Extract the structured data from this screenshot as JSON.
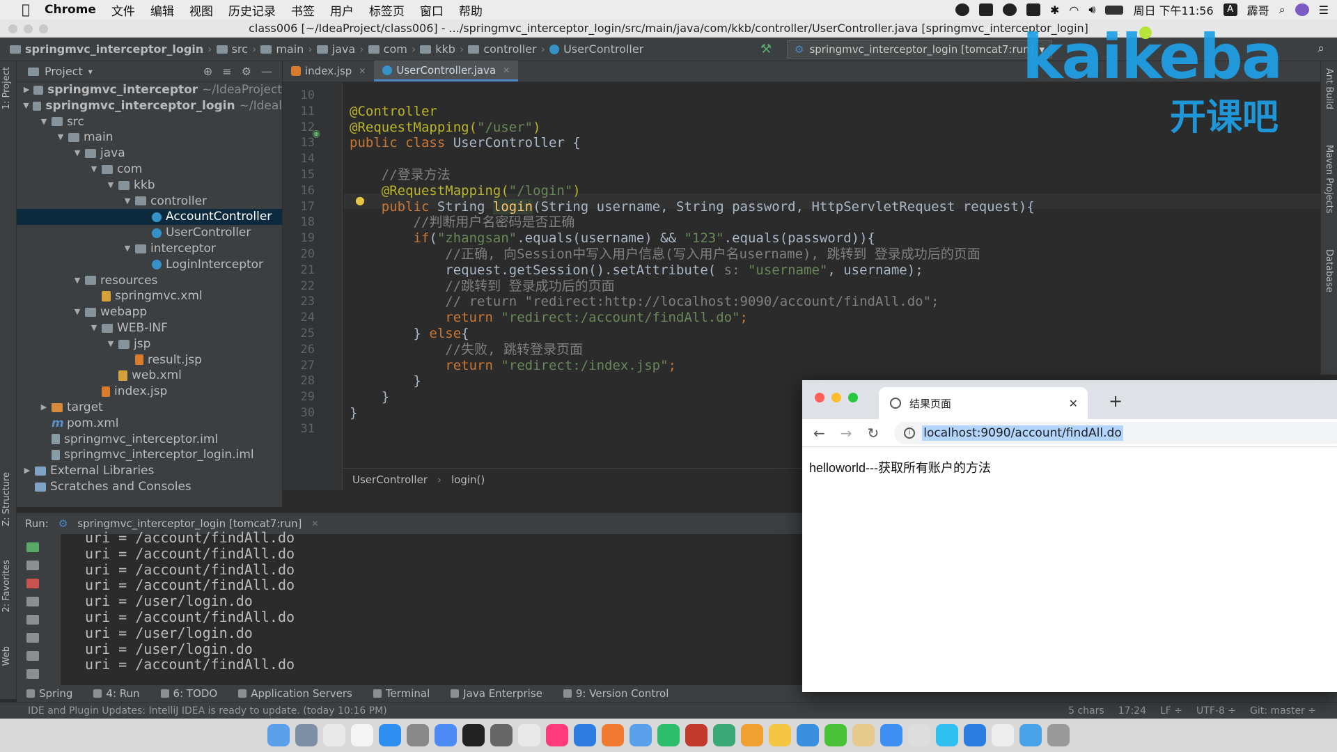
{
  "menubar": {
    "app": "Chrome",
    "items": [
      "文件",
      "编辑",
      "视图",
      "历史记录",
      "书签",
      "用户",
      "标签页",
      "窗口",
      "帮助"
    ],
    "datetime": "周日 下午11:56",
    "user": "霹哥"
  },
  "window_title": "class006 [~/IdeaProject/class006] - .../springmvc_interceptor_login/src/main/java/com/kkb/controller/UserController.java [springmvc_interceptor_login]",
  "breadcrumbs": [
    "springmvc_interceptor_login",
    "src",
    "main",
    "java",
    "com",
    "kkb",
    "controller",
    "UserController"
  ],
  "run_config": "springmvc_interceptor_login [tomcat7:run]",
  "project_panel": {
    "title": "Project"
  },
  "tree": [
    {
      "label": "springmvc_interceptor",
      "extra": "~/IdeaProject",
      "depth": 0,
      "arrow": "right",
      "type": "folder",
      "bold": true
    },
    {
      "label": "springmvc_interceptor_login",
      "extra": "~/Ideal",
      "depth": 0,
      "arrow": "down",
      "type": "folder",
      "bold": true
    },
    {
      "label": "src",
      "depth": 1,
      "arrow": "down",
      "type": "folder"
    },
    {
      "label": "main",
      "depth": 2,
      "arrow": "down",
      "type": "folder"
    },
    {
      "label": "java",
      "depth": 3,
      "arrow": "down",
      "type": "folder"
    },
    {
      "label": "com",
      "depth": 4,
      "arrow": "down",
      "type": "folder"
    },
    {
      "label": "kkb",
      "depth": 5,
      "arrow": "down",
      "type": "folder"
    },
    {
      "label": "controller",
      "depth": 6,
      "arrow": "down",
      "type": "folder"
    },
    {
      "label": "AccountController",
      "depth": 7,
      "type": "cls",
      "selected": true
    },
    {
      "label": "UserController",
      "depth": 7,
      "type": "cls"
    },
    {
      "label": "interceptor",
      "depth": 6,
      "arrow": "down",
      "type": "folder"
    },
    {
      "label": "LoginInterceptor",
      "depth": 7,
      "type": "cls"
    },
    {
      "label": "resources",
      "depth": 3,
      "arrow": "down",
      "type": "folder"
    },
    {
      "label": "springmvc.xml",
      "depth": 4,
      "type": "xml"
    },
    {
      "label": "webapp",
      "depth": 3,
      "arrow": "down",
      "type": "folder"
    },
    {
      "label": "WEB-INF",
      "depth": 4,
      "arrow": "down",
      "type": "folder"
    },
    {
      "label": "jsp",
      "depth": 5,
      "arrow": "down",
      "type": "folder"
    },
    {
      "label": "result.jsp",
      "depth": 6,
      "type": "jsp"
    },
    {
      "label": "web.xml",
      "depth": 5,
      "type": "xml"
    },
    {
      "label": "index.jsp",
      "depth": 4,
      "type": "jsp"
    },
    {
      "label": "target",
      "depth": 1,
      "arrow": "right",
      "type": "tgt"
    },
    {
      "label": "pom.xml",
      "depth": 1,
      "type": "pom"
    },
    {
      "label": "springmvc_interceptor.iml",
      "depth": 1,
      "type": "iml"
    },
    {
      "label": "springmvc_interceptor_login.iml",
      "depth": 1,
      "type": "iml"
    },
    {
      "label": "External Libraries",
      "depth": 0,
      "arrow": "right",
      "type": "lib"
    },
    {
      "label": "Scratches and Consoles",
      "depth": 0,
      "type": "lib"
    }
  ],
  "editor_tabs": [
    {
      "label": "index.jsp",
      "icon": "jsp-icon",
      "active": false
    },
    {
      "label": "UserController.java",
      "icon": "class-icon",
      "active": true
    }
  ],
  "line_numbers": [
    "10",
    "11",
    "12",
    "13",
    "14",
    "15",
    "16",
    "17",
    "18",
    "19",
    "20",
    "21",
    "22",
    "23",
    "24",
    "25",
    "26",
    "27",
    "28",
    "29",
    "30",
    "31"
  ],
  "code_lines": [
    [],
    [
      {
        "t": "@Controller",
        "c": "an"
      }
    ],
    [
      {
        "t": "@RequestMapping(",
        "c": "an"
      },
      {
        "t": "\"/user\"",
        "c": "st"
      },
      {
        "t": ")",
        "c": "an"
      }
    ],
    [
      {
        "t": "public class ",
        "c": "kw"
      },
      {
        "t": "UserController {",
        "c": ""
      }
    ],
    [],
    [
      {
        "t": "    //登录方法",
        "c": "cm"
      }
    ],
    [
      {
        "t": "    @RequestMapping(",
        "c": "an"
      },
      {
        "t": "\"/login\"",
        "c": "st"
      },
      {
        "t": ")",
        "c": "an"
      }
    ],
    [
      {
        "t": "    public ",
        "c": "kw"
      },
      {
        "t": "String ",
        "c": ""
      },
      {
        "t": "login",
        "c": "fn hl"
      },
      {
        "t": "(String username, String password, HttpServletRequest request){",
        "c": ""
      }
    ],
    [
      {
        "t": "        //判断用户名密码是否正确",
        "c": "cm"
      }
    ],
    [
      {
        "t": "        if",
        "c": "kw"
      },
      {
        "t": "(",
        "c": ""
      },
      {
        "t": "\"zhangsan\"",
        "c": "st"
      },
      {
        "t": ".equals(username) && ",
        "c": ""
      },
      {
        "t": "\"123\"",
        "c": "st"
      },
      {
        "t": ".equals(password)){",
        "c": ""
      }
    ],
    [
      {
        "t": "            //正确, 向Session中写入用户信息(写入用户名username), 跳转到 登录成功后的页面",
        "c": "cm"
      }
    ],
    [
      {
        "t": "            request.getSession().setAttribute( ",
        "c": ""
      },
      {
        "t": "s: ",
        "c": "cm"
      },
      {
        "t": "\"username\"",
        "c": "st"
      },
      {
        "t": ", username);",
        "c": ""
      }
    ],
    [
      {
        "t": "            //跳转到 登录成功后的页面",
        "c": "cm"
      }
    ],
    [
      {
        "t": "            // return \"redirect:http://localhost:9090/account/findAll.do\";",
        "c": "cm"
      }
    ],
    [
      {
        "t": "            return ",
        "c": "kw"
      },
      {
        "t": "\"redirect:/account/findAll.do\"",
        "c": "st"
      },
      {
        "t": ";",
        "c": "kw"
      }
    ],
    [
      {
        "t": "        } ",
        "c": ""
      },
      {
        "t": "else",
        "c": "kw"
      },
      {
        "t": "{",
        "c": ""
      }
    ],
    [
      {
        "t": "            //失败, 跳转登录页面",
        "c": "cm"
      }
    ],
    [
      {
        "t": "            return ",
        "c": "kw"
      },
      {
        "t": "\"redirect:/index.jsp\"",
        "c": "st"
      },
      {
        "t": ";",
        "c": "kw"
      }
    ],
    [
      {
        "t": "        }",
        "c": ""
      }
    ],
    [
      {
        "t": "    }",
        "c": ""
      }
    ],
    [
      {
        "t": "}",
        "c": ""
      }
    ],
    []
  ],
  "editor_breadcrumb": [
    "UserController",
    "login()"
  ],
  "run_panel": {
    "label": "Run:",
    "config": "springmvc_interceptor_login [tomcat7:run]",
    "console": [
      "uri = /account/findAll.do",
      "uri = /account/findAll.do",
      "uri = /account/findAll.do",
      "uri = /account/findAll.do",
      "uri = /user/login.do",
      "uri = /account/findAll.do",
      "uri = /user/login.do",
      "uri = /user/login.do",
      "uri = /account/findAll.do"
    ]
  },
  "bottom_tabs": [
    "Spring",
    "4: Run",
    "6: TODO",
    "Application Servers",
    "Terminal",
    "Java Enterprise",
    "9: Version Control"
  ],
  "left_vertical_tabs": [
    "1: Project",
    "Z: Structure",
    "2: Favorites",
    "Web"
  ],
  "right_vertical_tabs": [
    "Ant Build",
    "Maven Projects",
    "Database"
  ],
  "status": {
    "message": "IDE and Plugin Updates: IntelliJ IDEA is ready to update. (today 10:16 PM)",
    "chars": "5 chars",
    "position": "17:24",
    "line_sep": "LF ÷",
    "encoding": "UTF-8 ÷",
    "git": "Git: master ÷"
  },
  "browser": {
    "tab_title": "结果页面",
    "url": "localhost:9090/account/findAll.do",
    "body_text": "helloworld---获取所有账户的方法"
  },
  "watermark": {
    "brand": "kaikeba",
    "cn": "开课吧"
  },
  "colors": {
    "accent": "#4a88c7",
    "selection": "#0d293e",
    "brand": "#1fa0e6"
  }
}
